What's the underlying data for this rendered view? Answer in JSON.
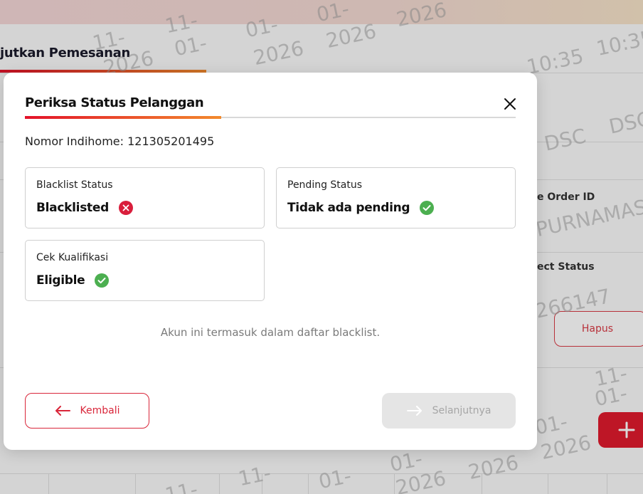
{
  "background": {
    "page_title": "jutkan Pemesanan",
    "label_order_id": "e Order ID",
    "label_project_status": "ect Status",
    "delete_label": "Hapus",
    "watermark_lines": [
      "11-",
      "01-",
      "2026",
      "10:35",
      "DSC",
      "PURNAMASA",
      "266147"
    ]
  },
  "modal": {
    "title": "Periksa Status Pelanggan",
    "close_icon": "close-icon",
    "nomor_label": "Nomor Indihome: 121305201495",
    "cards": [
      {
        "label": "Blacklist Status",
        "value": "Blacklisted",
        "status": "error",
        "icon": "x-circle-icon"
      },
      {
        "label": "Pending Status",
        "value": "Tidak ada pending",
        "status": "ok",
        "icon": "check-circle-icon"
      },
      {
        "label": "Cek Kualifikasi",
        "value": "Eligible",
        "status": "ok",
        "icon": "check-circle-icon"
      }
    ],
    "message": "Akun ini termasuk dalam daftar blacklist.",
    "back_label": "Kembali",
    "next_label": "Selanjutnya"
  },
  "colors": {
    "accent_red": "#e3122a",
    "accent_orange": "#f28a2c",
    "error_red": "#d91e3c",
    "ok_green": "#4caf50",
    "disabled_bg": "#e5e5e5"
  }
}
